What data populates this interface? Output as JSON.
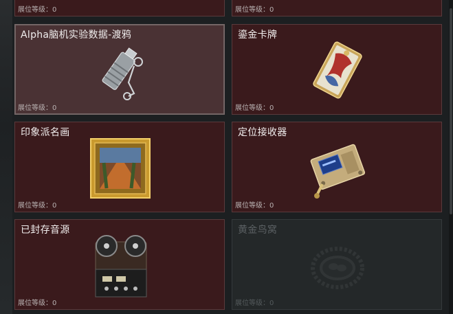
{
  "level_label": "展位等级：0",
  "cards": [
    {
      "name": "",
      "level": "展位等级：0"
    },
    {
      "name": "",
      "level": "展位等级：0"
    },
    {
      "name": "Alpha脑机实验数据-渡鸦",
      "level": "展位等级：0"
    },
    {
      "name": "鎏金卡牌",
      "level": "展位等级：0"
    },
    {
      "name": "印象派名画",
      "level": "展位等级：0"
    },
    {
      "name": "定位接收器",
      "level": "展位等级：0"
    },
    {
      "name": "已封存音源",
      "level": "展位等级：0"
    },
    {
      "name": "黄金鸟窝",
      "level": "展位等级：0"
    }
  ],
  "colors": {
    "card_bg": "#3a1a1c",
    "selected_bg": "#4a3234",
    "locked_bg": "#242829"
  }
}
